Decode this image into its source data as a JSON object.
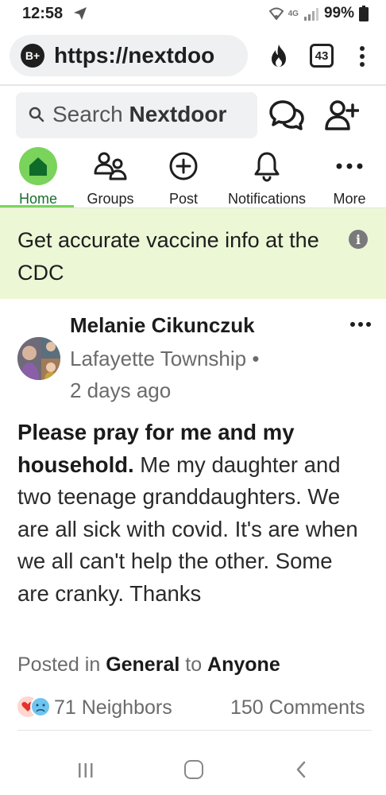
{
  "status_bar": {
    "time": "12:58",
    "battery_percent": "99%",
    "network": "4G"
  },
  "browser": {
    "site_badge": "B+",
    "url": "https://nextdoo",
    "tab_count": "43"
  },
  "header": {
    "search_prefix": "Search",
    "search_brand": "Nextdoor"
  },
  "nav": {
    "items": [
      {
        "label": "Home",
        "icon": "home-icon",
        "active": true
      },
      {
        "label": "Groups",
        "icon": "groups-icon"
      },
      {
        "label": "Post",
        "icon": "plus-circle-icon"
      },
      {
        "label": "Notifications",
        "icon": "bell-icon"
      },
      {
        "label": "More",
        "icon": "more-dots-icon"
      }
    ]
  },
  "banner": {
    "text": "Get accurate vaccine info at the CDC",
    "info_glyph": "i"
  },
  "post": {
    "author": "Melanie Cikunczuk",
    "location": "Lafayette Township •",
    "time": "2 days ago",
    "body_bold": "Please pray for me and my household.",
    "body_text": " Me my daughter and two teenage granddaughters. We are all sick with covid. It's are when we all can't help the other. Some are cranky. Thanks",
    "posted_in_prefix": "Posted in ",
    "category": "General",
    "to_text": " to ",
    "audience": "Anyone",
    "neighbors": "71 Neighbors",
    "comments": "150 Comments"
  },
  "colors": {
    "accent_green": "#7ad35b",
    "banner_bg": "#ecf7d6",
    "muted_text": "#6b6b6b"
  }
}
